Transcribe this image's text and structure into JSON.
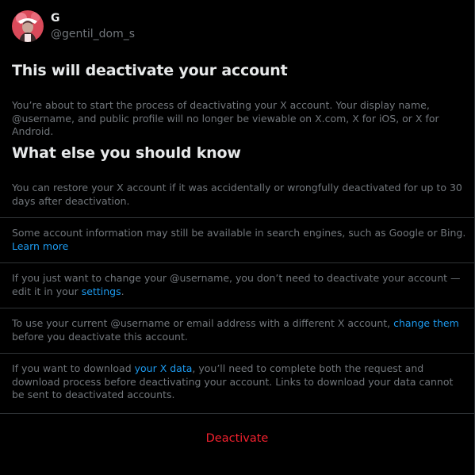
{
  "profile": {
    "display_name": "G",
    "handle": "@gentil_dom_s"
  },
  "section1": {
    "heading": "This will deactivate your account",
    "text": "You’re about to start the process of deactivating your X account. Your display name, @username, and public profile will no longer be viewable on X.com, X for iOS, or X for Android."
  },
  "section2": {
    "heading": "What else you should know",
    "items": [
      {
        "text": "You can restore your X account if it was accidentally or wrongfully deactivated for up to 30 days after deactivation."
      },
      {
        "text_before": "Some account information may still be available in search engines, such as Google or Bing. ",
        "link": "Learn more"
      },
      {
        "text_before": "If you just want to change your @username, you don’t need to deactivate your account — edit it in your ",
        "link": "settings",
        "text_after": "."
      },
      {
        "text_before": "To use your current @username or email address with a different X account, ",
        "link": "change them",
        "text_after": " before you deactivate this account."
      },
      {
        "text_before": "If you want to download ",
        "link": "your X data",
        "text_after": ", you’ll need to complete both the request and download process before deactivating your account. Links to download your data cannot be sent to deactivated accounts."
      }
    ]
  },
  "actions": {
    "deactivate_label": "Deactivate"
  },
  "colors": {
    "background": "#000000",
    "text_primary": "#e7e9ea",
    "text_secondary": "#71767b",
    "link": "#1d9bf0",
    "danger": "#f4212e",
    "border": "#2f3336"
  }
}
